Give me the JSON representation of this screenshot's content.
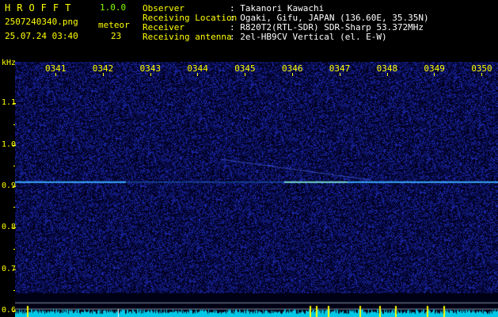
{
  "header": {
    "app_name": "HROFFT",
    "app_version": "1.0.0",
    "filename": "2507240340.png",
    "meteor_label": "meteor",
    "meteor_count": "23",
    "datetime": "25.07.24 03:40",
    "info_labels": [
      "Observer",
      "Receiving Location",
      "Receiver",
      "Receiving antenna"
    ],
    "info_values": [
      ": Takanori Kawachi",
      ": Ogaki, Gifu, JAPAN (136.60E, 35.35N)",
      ": R820T2(RTL-SDR) SDR-Sharp 53.372MHz",
      ": 2el-HB9CV Vertical (el. E-W)"
    ]
  },
  "chart_data": {
    "type": "heatmap",
    "ylabel": "kHz",
    "x_ticks": [
      "0341",
      "0342",
      "0343",
      "0344",
      "0345",
      "0346",
      "0347",
      "0348",
      "0349",
      "0350"
    ],
    "y_ticks": [
      "1.1",
      "1.0",
      "0.9",
      "0.8",
      "0.7",
      "0.6"
    ],
    "ylim": [
      0.585,
      1.2
    ],
    "carrier_khz": 0.91,
    "colors": {
      "background": "#000014",
      "noise": "#1e28a0",
      "carrier": "#3aa8ff",
      "spectrum": "#00c8e6",
      "peak": "#ffff00",
      "axis": "#ffff00"
    }
  }
}
